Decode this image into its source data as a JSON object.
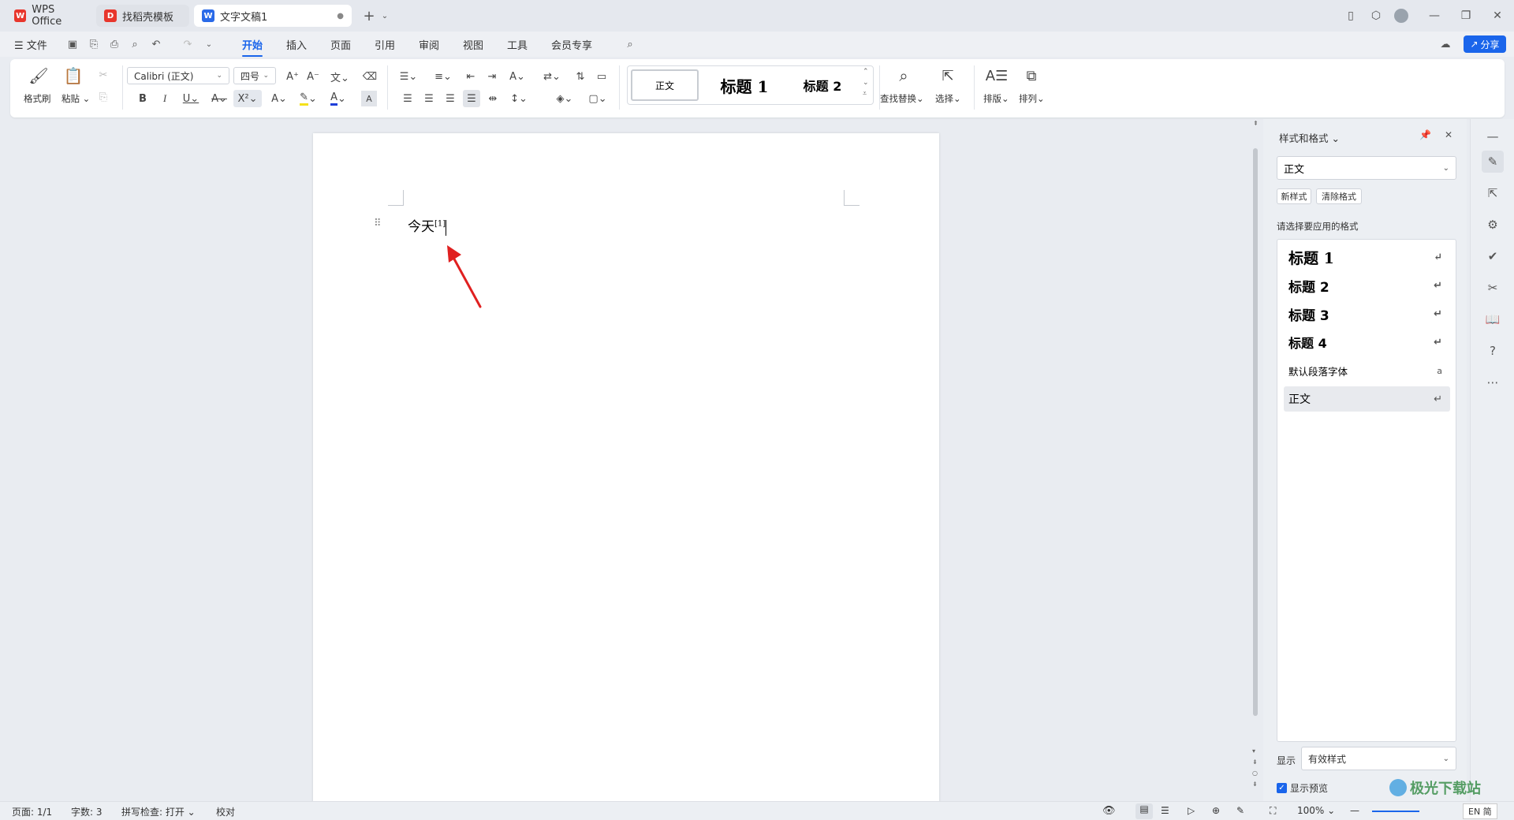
{
  "tabs": [
    {
      "label": "WPS Office",
      "icon": "wps-logo"
    },
    {
      "label": "找稻壳模板",
      "icon": "docer-logo"
    },
    {
      "label": "文字文稿1",
      "icon": "word-doc-logo"
    }
  ],
  "menu": {
    "file": "文件",
    "items": [
      "开始",
      "插入",
      "页面",
      "引用",
      "审阅",
      "视图",
      "工具",
      "会员专享"
    ],
    "active": "开始",
    "share": "分享"
  },
  "ribbon": {
    "format_painter": "格式刷",
    "paste": "粘贴",
    "font_name": "Calibri (正文)",
    "font_size": "四号",
    "styles": [
      "正文",
      "标题 1",
      "标题 2"
    ],
    "find_replace": "查找替换",
    "select": "选择",
    "layout": "排版",
    "arrange": "排列"
  },
  "document": {
    "text": "今天",
    "footnote_ref": "[1]"
  },
  "panel": {
    "title": "样式和格式",
    "current_style": "正文",
    "new_style": "新样式",
    "clear_format": "清除格式",
    "prompt": "请选择要应用的格式",
    "styles": [
      {
        "label": "标题 1",
        "kind": "heading"
      },
      {
        "label": "标题 2",
        "kind": "heading"
      },
      {
        "label": "标题 3",
        "kind": "heading"
      },
      {
        "label": "标题 4",
        "kind": "heading"
      },
      {
        "label": "默认段落字体",
        "kind": "char"
      },
      {
        "label": "正文",
        "kind": "para"
      }
    ],
    "show_label": "显示",
    "show_value": "有效样式",
    "preview_label": "显示预览"
  },
  "status": {
    "page": "页面: 1/1",
    "words": "字数: 3",
    "spell": "拼写检查: 打开",
    "proof": "校对",
    "zoom": "100%",
    "ime": "EN 简"
  },
  "watermark": "极光下载站",
  "colors": {
    "accent": "#1a65eb",
    "annotation_arrow": "#e02020",
    "highlight": "#f5e11b",
    "font_color": "#1f3fd8"
  }
}
